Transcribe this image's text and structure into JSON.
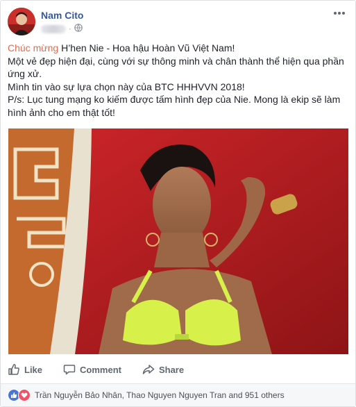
{
  "post": {
    "author": "Nam Cito",
    "lead": "Chúc mừng",
    "lines": [
      "H’hen Nie - Hoa hậu Hoàn Vũ Việt Nam!",
      "Một vẻ đẹp hiện đại, cùng với sự thông minh và chân thành thể hiện qua phần ứng xử.",
      "Mình tin vào sự lựa chọn này của BTC HHHVVN 2018!",
      "P/s: Lục tung mạng ko kiếm được tấm hình đẹp của Nie. Mong là ekip sẽ làm hình ảnh cho em thật tốt!"
    ]
  },
  "actions": {
    "like": "Like",
    "comment": "Comment",
    "share": "Share"
  },
  "reactions": {
    "names": "Trần Nguyễn Bảo Nhân, Thao Nguyen Nguyen Tran and 951 others"
  },
  "colors": {
    "link": "#365899",
    "lead": "#e8684a",
    "photo_bg": "#b51a1c",
    "accent_lime": "#d7f04a"
  },
  "icons": [
    "more-options-icon",
    "globe-icon",
    "like-icon",
    "comment-icon",
    "share-icon",
    "like-reaction-icon",
    "love-reaction-icon"
  ]
}
